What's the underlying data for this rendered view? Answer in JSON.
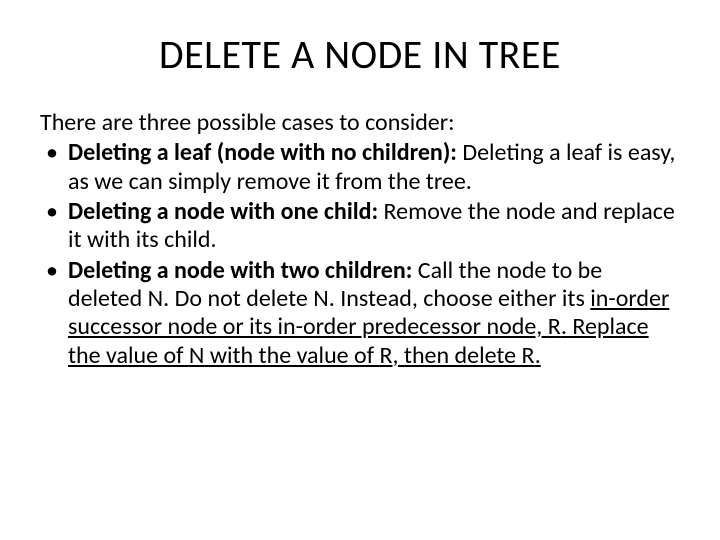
{
  "title": "DELETE A NODE IN TREE",
  "intro": "There are three possible cases to consider:",
  "bullets": [
    {
      "bold": "Deleting a leaf (node with no children): ",
      "rest": "Deleting a leaf is easy, as we can simply remove it from the tree."
    },
    {
      "bold": "Deleting a node with one child: ",
      "rest": "Remove the node and replace it with its child."
    },
    {
      "bold": "Deleting a node with two children: ",
      "rest_pre": "Call the node to be deleted ",
      "n1": "N",
      "rest_mid1": ". Do not delete ",
      "n2": "N",
      "rest_mid2": ". Instead, choose either its ",
      "ul1": "in-order successor node or its in-order predecessor node, ",
      "r1": "R",
      "rest_mid3": ". Replace the value of ",
      "n3": "N",
      "rest_mid4": " with the value of ",
      "r2": "R",
      "rest_mid5": ", then delete ",
      "r3": "R",
      "rest_end": "."
    }
  ]
}
